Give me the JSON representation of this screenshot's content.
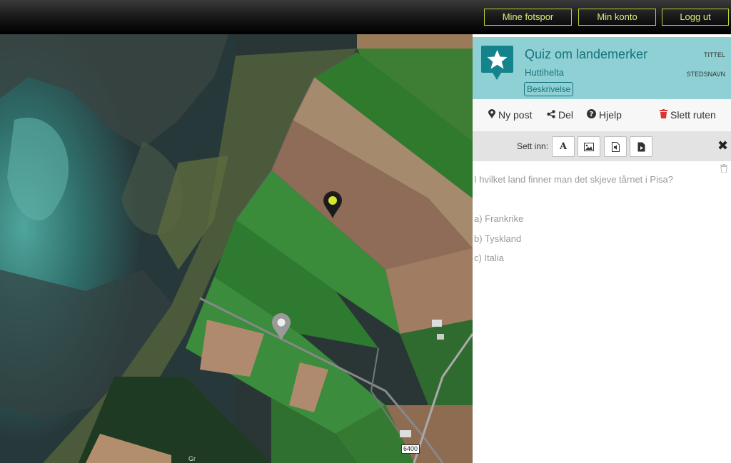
{
  "topnav": {
    "my_footprints": "Mine fotspor",
    "my_account": "Min konto",
    "logout": "Logg ut"
  },
  "map": {
    "road_label": "6400",
    "place_label_fragment": "Gr",
    "pins": [
      {
        "name": "active-post-pin",
        "color": "#d4e72b"
      },
      {
        "name": "inactive-post-pin",
        "color": "#9a9a9a"
      }
    ]
  },
  "route": {
    "title": "Quiz om landemerker",
    "author": "Huttihelta",
    "description_button": "Beskrivelse",
    "title_label": "TITTEL",
    "place_label": "STEDSNAVN",
    "logo_icon": "star-marker-icon",
    "accent_color": "#8fd0d4"
  },
  "actions": {
    "new_post": "Ny post",
    "share": "Del",
    "help": "Hjelp",
    "delete_route": "Slett ruten"
  },
  "insert": {
    "label": "Sett inn:",
    "text_button": "A",
    "icons": [
      "text-icon",
      "image-icon",
      "audio-file-icon",
      "video-file-icon"
    ]
  },
  "post": {
    "question": "I hvilket land finner man det skjeve tårnet i Pisa?",
    "options": [
      "a) Frankrike",
      "b) Tyskland",
      "c) Italia"
    ]
  }
}
